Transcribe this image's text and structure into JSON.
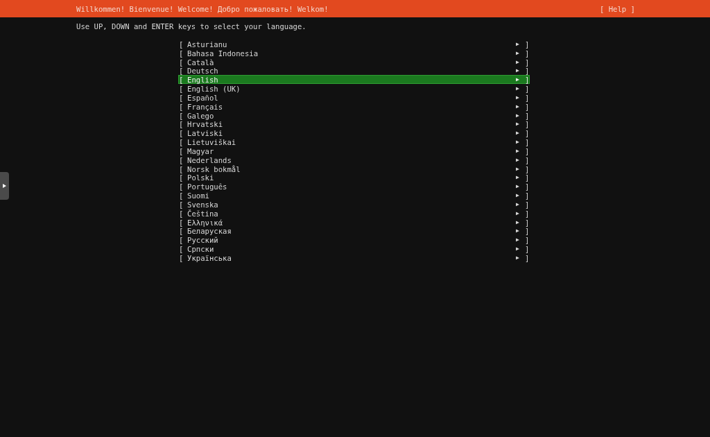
{
  "header": {
    "title": "Willkommen! Bienvenue! Welcome! Добро пожаловать! Welkom!",
    "help": "[ Help ]"
  },
  "instruction": "Use UP, DOWN and ENTER keys to select your language.",
  "languages": [
    {
      "open": "[",
      "label": "Asturianu",
      "arrow": "▶",
      "close": "]",
      "selected": false
    },
    {
      "open": "[",
      "label": "Bahasa Indonesia",
      "arrow": "▶",
      "close": "]",
      "selected": false
    },
    {
      "open": "[",
      "label": "Català",
      "arrow": "▶",
      "close": "]",
      "selected": false
    },
    {
      "open": "[",
      "label": "Deutsch",
      "arrow": "▶",
      "close": "]",
      "selected": false
    },
    {
      "open": "[",
      "label": "English",
      "arrow": "▶",
      "close": "]",
      "selected": true
    },
    {
      "open": "[",
      "label": "English (UK)",
      "arrow": "▶",
      "close": "]",
      "selected": false
    },
    {
      "open": "[",
      "label": "Español",
      "arrow": "▶",
      "close": "]",
      "selected": false
    },
    {
      "open": "[",
      "label": "Français",
      "arrow": "▶",
      "close": "]",
      "selected": false
    },
    {
      "open": "[",
      "label": "Galego",
      "arrow": "▶",
      "close": "]",
      "selected": false
    },
    {
      "open": "[",
      "label": "Hrvatski",
      "arrow": "▶",
      "close": "]",
      "selected": false
    },
    {
      "open": "[",
      "label": "Latviski",
      "arrow": "▶",
      "close": "]",
      "selected": false
    },
    {
      "open": "[",
      "label": "Lietuviškai",
      "arrow": "▶",
      "close": "]",
      "selected": false
    },
    {
      "open": "[",
      "label": "Magyar",
      "arrow": "▶",
      "close": "]",
      "selected": false
    },
    {
      "open": "[",
      "label": "Nederlands",
      "arrow": "▶",
      "close": "]",
      "selected": false
    },
    {
      "open": "[",
      "label": "Norsk bokmål",
      "arrow": "▶",
      "close": "]",
      "selected": false
    },
    {
      "open": "[",
      "label": "Polski",
      "arrow": "▶",
      "close": "]",
      "selected": false
    },
    {
      "open": "[",
      "label": "Português",
      "arrow": "▶",
      "close": "]",
      "selected": false
    },
    {
      "open": "[",
      "label": "Suomi",
      "arrow": "▶",
      "close": "]",
      "selected": false
    },
    {
      "open": "[",
      "label": "Svenska",
      "arrow": "▶",
      "close": "]",
      "selected": false
    },
    {
      "open": "[",
      "label": "Čeština",
      "arrow": "▶",
      "close": "]",
      "selected": false
    },
    {
      "open": "[",
      "label": "Ελληνικά",
      "arrow": "▶",
      "close": "]",
      "selected": false
    },
    {
      "open": "[",
      "label": "Беларуская",
      "arrow": "▶",
      "close": "]",
      "selected": false
    },
    {
      "open": "[",
      "label": "Русский",
      "arrow": "▶",
      "close": "]",
      "selected": false
    },
    {
      "open": "[",
      "label": "Српски",
      "arrow": "▶",
      "close": "]",
      "selected": false
    },
    {
      "open": "[",
      "label": "Українська",
      "arrow": "▶",
      "close": "]",
      "selected": false
    }
  ]
}
